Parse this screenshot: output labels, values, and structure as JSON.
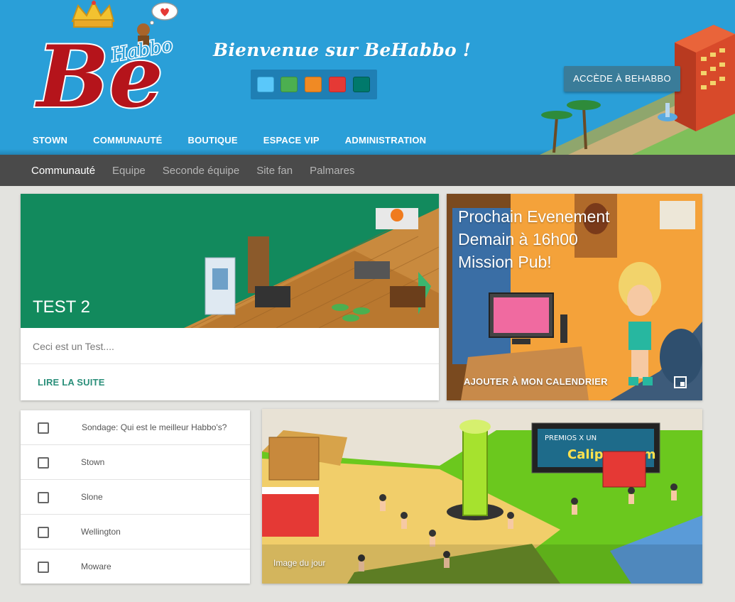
{
  "brand": {
    "logo_text_big": "Be",
    "logo_text_small": "Habbo"
  },
  "header": {
    "welcome": "Bienvenue sur BeHabbo !",
    "access_button": "ACCÈDE À BEHABBO",
    "theme_colors": [
      "#5ac8fa",
      "#4caf50",
      "#f08a24",
      "#e53935",
      "#00796b"
    ]
  },
  "main_nav": {
    "items": [
      "STOWN",
      "COMMUNAUTÉ",
      "BOUTIQUE",
      "ESPACE VIP",
      "ADMINISTRATION"
    ]
  },
  "sub_nav": {
    "items": [
      "Communauté",
      "Equipe",
      "Seconde équipe",
      "Site fan",
      "Palmares"
    ],
    "active": "Communauté"
  },
  "article": {
    "title": "TEST 2",
    "body": "Ceci est un Test....",
    "link": "LIRE LA SUITE"
  },
  "event": {
    "line1": "Prochain Evenement",
    "line2": "Demain à 16h00",
    "line3": "Mission Pub!",
    "link": "AJOUTER À MON CALENDRIER"
  },
  "poll": {
    "question": "Sondage: Qui est le meilleur Habbo's?",
    "options": [
      "Stown",
      "Slone",
      "Wellington",
      "Moware"
    ]
  },
  "daily_image": {
    "caption": "Image du jour",
    "sign_text": "Calippo.com",
    "sign_top": "PREMIOS X UN"
  }
}
